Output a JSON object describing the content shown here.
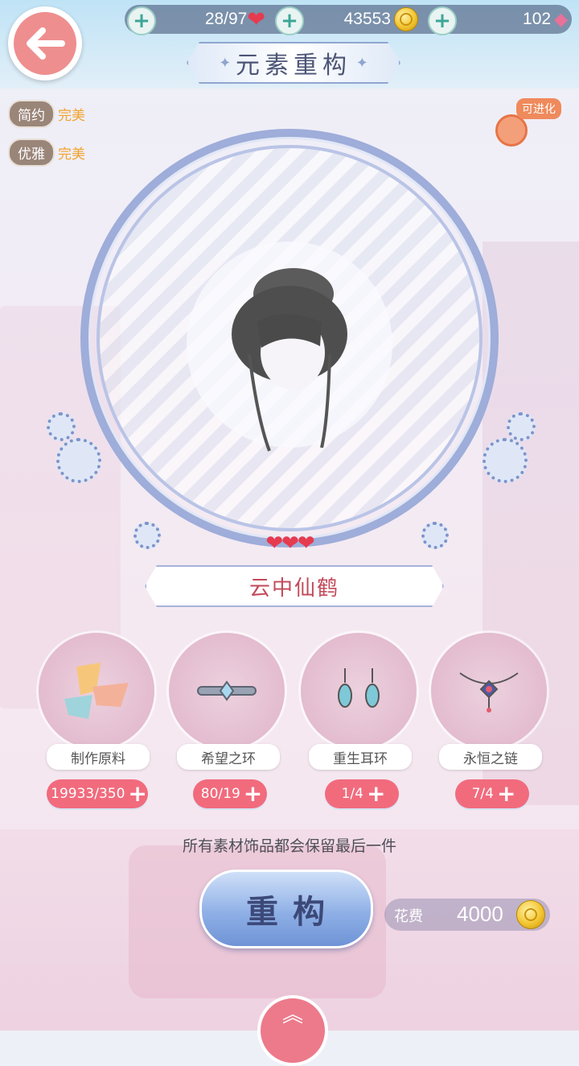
{
  "header": {
    "stamina": "28/97",
    "gold": "43553",
    "diamonds": "102",
    "title": "元素重构"
  },
  "style_tags": [
    {
      "label": "简约",
      "value": "完美"
    },
    {
      "label": "优雅",
      "value": "完美"
    }
  ],
  "evolve_badge": {
    "label": "可进化",
    "icon": "yarn-spool-icon"
  },
  "item": {
    "name": "云中仙鹤",
    "hearts": "❤❤❤",
    "rarity": 3
  },
  "materials": [
    {
      "name": "制作原料",
      "count": "19933/350",
      "icon": "fabric-scraps-icon"
    },
    {
      "name": "希望之环",
      "count": "80/19",
      "icon": "ring-icon"
    },
    {
      "name": "重生耳环",
      "count": "1/4",
      "icon": "earrings-icon"
    },
    {
      "name": "永恒之链",
      "count": "7/4",
      "icon": "necklace-icon"
    }
  ],
  "notice": "所有素材饰品都会保留最后一件",
  "rebuild_button": {
    "label": "重构"
  },
  "cost": {
    "label": "花费",
    "value": "4000"
  },
  "colors": {
    "accent_pink": "#f16b7d",
    "ring_blue": "#9eadd9",
    "button_blue": "#8fb0e6",
    "tag_gold": "#f2a32d"
  }
}
